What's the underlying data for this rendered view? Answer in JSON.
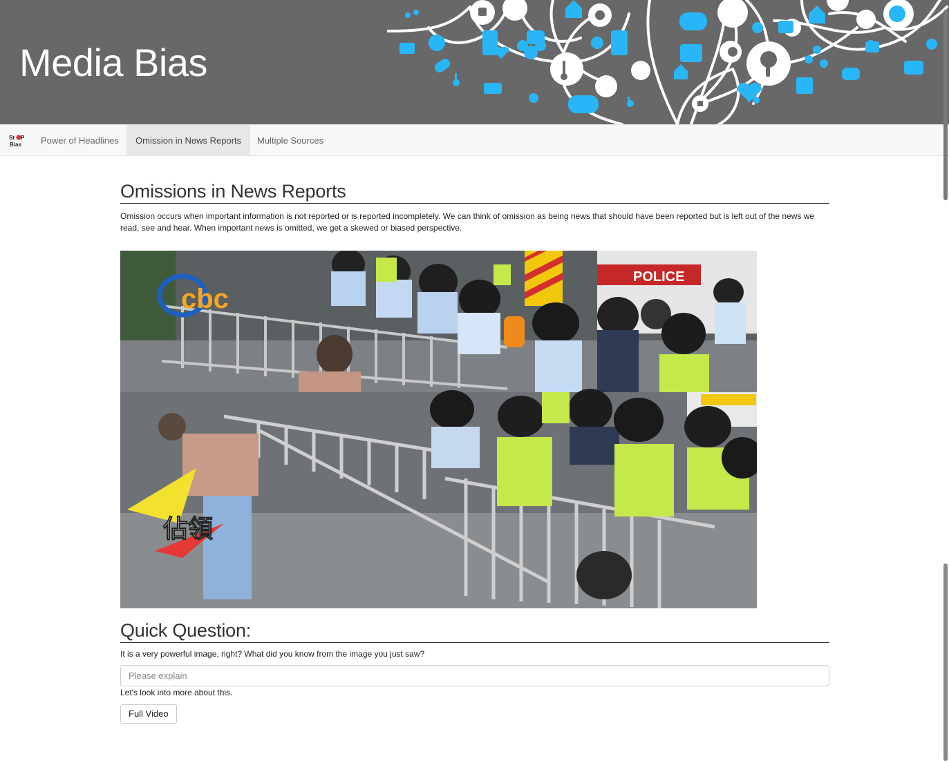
{
  "header": {
    "title": "Media Bias",
    "art_colors": {
      "accent": "#29b6f6",
      "line": "#ffffff"
    }
  },
  "navbar": {
    "brand_logo": "Stop Bias",
    "items": [
      {
        "label": "Power of Headlines",
        "active": false
      },
      {
        "label": "Omission in News Reports",
        "active": true
      },
      {
        "label": "Multiple Sources",
        "active": false
      }
    ]
  },
  "main": {
    "heading": "Omissions in News Reports",
    "intro": "Omission occurs when important information is not reported or is reported incompletely. We can think of omission as being news that should have been reported but is left out of the news we read, see and hear. When important news is omitted, we get a skewed or biased perspective.",
    "image": {
      "alt": "cbc",
      "overlay_text": "佔領",
      "sign_text": "POLICE"
    }
  },
  "quick_question": {
    "heading": "Quick Question:",
    "prompt": "It is a very powerful image, right? What did you know from the image you just saw?",
    "answer_placeholder": "Please explain",
    "followup": "Let's look into more about this.",
    "button_label": "Full Video"
  }
}
